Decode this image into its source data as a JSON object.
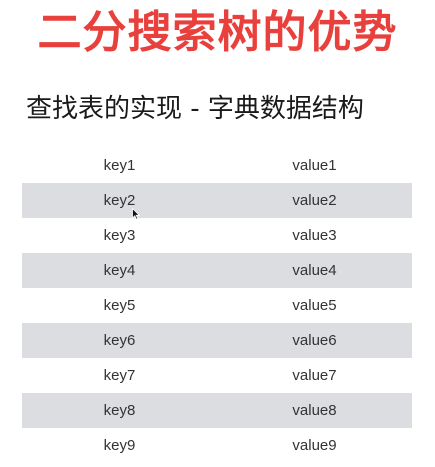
{
  "slide": {
    "title": "二分搜索树的优势",
    "subtitle": "查找表的实现 - 字典数据结构"
  },
  "table": {
    "rows": [
      {
        "key": "key1",
        "value": "value1"
      },
      {
        "key": "key2",
        "value": "value2"
      },
      {
        "key": "key3",
        "value": "value3"
      },
      {
        "key": "key4",
        "value": "value4"
      },
      {
        "key": "key5",
        "value": "value5"
      },
      {
        "key": "key6",
        "value": "value6"
      },
      {
        "key": "key7",
        "value": "value7"
      },
      {
        "key": "key8",
        "value": "value8"
      },
      {
        "key": "key9",
        "value": "value9"
      }
    ]
  },
  "colors": {
    "title": "#e8403c",
    "text": "#1a1a1a",
    "row_shade": "#dcdde1"
  },
  "icons": {
    "cursor": "mouse-pointer-icon"
  }
}
